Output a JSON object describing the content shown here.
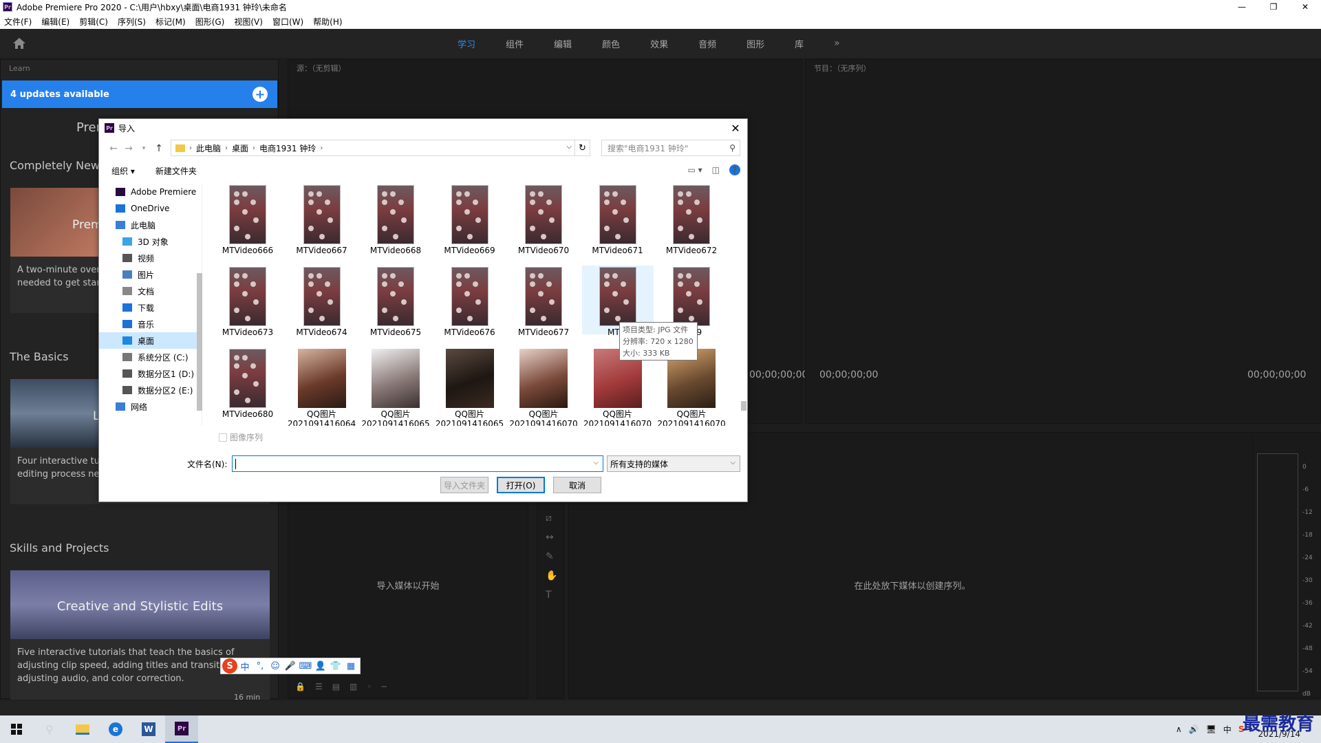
{
  "app": {
    "title": "Adobe Premiere Pro 2020 - C:\\用户\\hbxy\\桌面\\电商1931 钟玲\\未命名",
    "logo": "Pr",
    "min": "—",
    "max": "❐",
    "close": "✕"
  },
  "menu": [
    "文件(F)",
    "编辑(E)",
    "剪辑(C)",
    "序列(S)",
    "标记(M)",
    "图形(G)",
    "视图(V)",
    "窗口(W)",
    "帮助(H)"
  ],
  "workspaces": {
    "tabs": [
      "学习",
      "组件",
      "编辑",
      "颜色",
      "效果",
      "音频",
      "图形",
      "库"
    ],
    "active": "学习",
    "more": "»"
  },
  "learn": {
    "header": "Learn",
    "updates": "4 updates available",
    "plus": "+",
    "partial_title": "Prer",
    "sections": [
      {
        "title": "Completely New",
        "img_text": "Prem",
        "desc": "A two-minute overv\nneeded to get start"
      },
      {
        "title": "The Basics",
        "img_text": "L",
        "desc": "Four interactive tut\nediting process nee"
      },
      {
        "title": "Skills and Projects",
        "img_text": "Creative and Stylistic Edits",
        "desc": "Five interactive tutorials that teach the basics of adjusting clip speed, adding titles and transitions, adjusting audio, and color correction.",
        "duration": "16 min"
      }
    ]
  },
  "source": {
    "header": "源：（无剪辑）",
    "timecode": "00;00;00;00"
  },
  "program": {
    "header": "节目：（无序列）",
    "timecode_left": "00;00;00;00",
    "timecode_right": "00;00;00;00"
  },
  "project": {
    "hint": "导入媒体以开始"
  },
  "timeline": {
    "hint": "在此处放下媒体以创建序列。"
  },
  "meter": {
    "labels": [
      "0",
      "-6",
      "-12",
      "-18",
      "-24",
      "-30",
      "-36",
      "-42",
      "-48",
      "-54",
      "dB"
    ]
  },
  "dialog": {
    "title": "导入",
    "logo": "Pr",
    "close": "✕",
    "breadcrumbs": [
      "此电脑",
      "桌面",
      "电商1931 钟玲"
    ],
    "search_placeholder": "搜索\"电商1931 钟玲\"",
    "organize": "组织 ▾",
    "new_folder": "新建文件夹",
    "nav": [
      {
        "label": "Adobe Premiere",
        "level": "top",
        "color": "#2a0a3f"
      },
      {
        "label": "OneDrive",
        "level": "top",
        "color": "#1a73d9"
      },
      {
        "label": "此电脑",
        "level": "top",
        "color": "#3b7dd8"
      },
      {
        "label": "3D 对象",
        "level": "sub",
        "color": "#3da3e8"
      },
      {
        "label": "视频",
        "level": "sub",
        "color": "#555555"
      },
      {
        "label": "图片",
        "level": "sub",
        "color": "#4a7fbf"
      },
      {
        "label": "文档",
        "level": "sub",
        "color": "#888888"
      },
      {
        "label": "下载",
        "level": "sub",
        "color": "#1a73d9"
      },
      {
        "label": "音乐",
        "level": "sub",
        "color": "#1a73d9"
      },
      {
        "label": "桌面",
        "level": "sub",
        "color": "#1e88e5",
        "selected": true
      },
      {
        "label": "系统分区 (C:)",
        "level": "sub",
        "color": "#777777"
      },
      {
        "label": "数据分区1 (D:)",
        "level": "sub",
        "color": "#555555"
      },
      {
        "label": "数据分区2 (E:)",
        "level": "sub",
        "color": "#555555"
      },
      {
        "label": "网络",
        "level": "top",
        "color": "#3b7dd8"
      }
    ],
    "files": [
      {
        "name": "MTVideo666",
        "kind": "thumb"
      },
      {
        "name": "MTVideo667",
        "kind": "thumb"
      },
      {
        "name": "MTVideo668",
        "kind": "thumb"
      },
      {
        "name": "MTVideo669",
        "kind": "thumb"
      },
      {
        "name": "MTVideo670",
        "kind": "thumb"
      },
      {
        "name": "MTVideo671",
        "kind": "thumb"
      },
      {
        "name": "MTVideo672",
        "kind": "thumb"
      },
      {
        "name": "MTVideo673",
        "kind": "thumb"
      },
      {
        "name": "MTVideo674",
        "kind": "thumb"
      },
      {
        "name": "MTVideo675",
        "kind": "thumb"
      },
      {
        "name": "MTVideo676",
        "kind": "thumb"
      },
      {
        "name": "MTVideo677",
        "kind": "thumb"
      },
      {
        "name": "MTVi",
        "kind": "thumb",
        "hover": true
      },
      {
        "name": "o679",
        "kind": "thumb"
      },
      {
        "name": "MTVideo680",
        "kind": "thumb"
      },
      {
        "name": "QQ图片\n2021091416064",
        "kind": "photo"
      },
      {
        "name": "QQ图片\n2021091416065",
        "kind": "photo"
      },
      {
        "name": "QQ图片\n2021091416065",
        "kind": "photo"
      },
      {
        "name": "QQ图片\n2021091416070",
        "kind": "photo"
      },
      {
        "name": "QQ图片\n2021091416070",
        "kind": "photo"
      },
      {
        "name": "QQ图片\n2021091416070",
        "kind": "photo"
      }
    ],
    "tooltip": [
      "项目类型: JPG 文件",
      "分辨率: 720 x 1280",
      "大小: 333 KB"
    ],
    "image_sequence": "图像序列",
    "filename_label": "文件名(N):",
    "filename_value": "",
    "filter": "所有支持的媒体",
    "import_folder": "导入文件夹",
    "open": "打开(O)",
    "cancel": "取消"
  },
  "ime": [
    "中",
    "°,",
    "☺",
    "🎤",
    "⌨",
    "👤",
    "👕",
    "▦"
  ],
  "taskbar": {
    "tray": [
      "∧",
      "🔊",
      "🖥",
      "中",
      "S"
    ],
    "date": "2021/9/14"
  },
  "watermark": "最需教育"
}
